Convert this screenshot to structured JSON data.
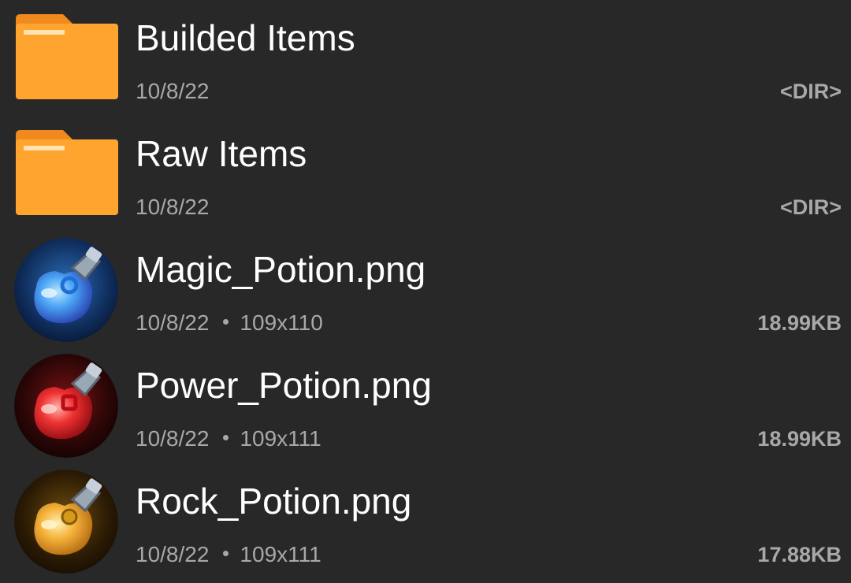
{
  "files": [
    {
      "name": "Builded Items",
      "date": "10/8/22",
      "size": "<DIR>",
      "icon": "folder-icon",
      "color": "#FFA52F"
    },
    {
      "name": "Raw Items",
      "date": "10/8/22",
      "size": "<DIR>",
      "icon": "folder-icon",
      "color": "#FFA52F"
    },
    {
      "name": "Magic_Potion.png",
      "date": "10/8/22",
      "dimensions": "109x110",
      "size": "18.99KB",
      "icon": "magic-potion-thumbnail",
      "color": "#3F8BEF"
    },
    {
      "name": "Power_Potion.png",
      "date": "10/8/22",
      "dimensions": "109x111",
      "size": "18.99KB",
      "icon": "power-potion-thumbnail",
      "color": "#E0262A"
    },
    {
      "name": "Rock_Potion.png",
      "date": "10/8/22",
      "dimensions": "109x111",
      "size": "17.88KB",
      "icon": "rock-potion-thumbnail",
      "color": "#F2A62B"
    }
  ]
}
